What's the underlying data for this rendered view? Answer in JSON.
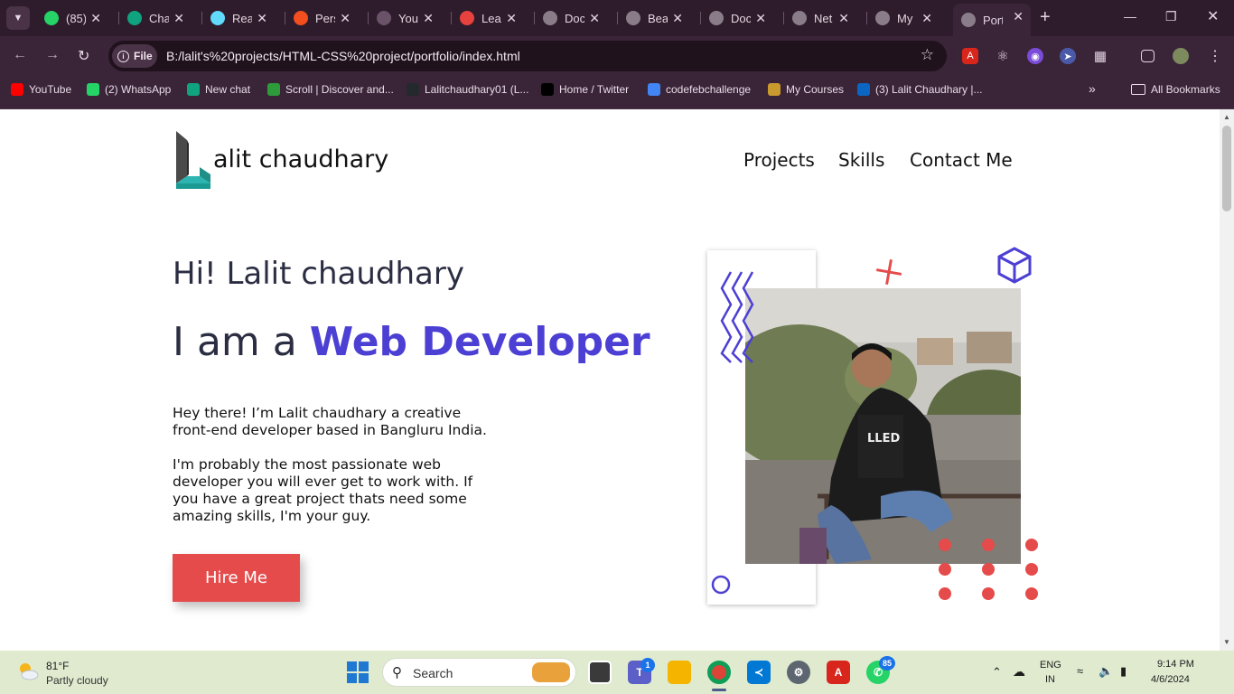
{
  "browser": {
    "tabs": [
      {
        "title": "(85)",
        "icon": "whatsapp-icon",
        "color": "#25d366"
      },
      {
        "title": "Cha",
        "icon": "chatgpt-icon",
        "color": "#10a37f"
      },
      {
        "title": "Rea",
        "icon": "react-icon",
        "color": "#61dafb"
      },
      {
        "title": "Pers",
        "icon": "figma-icon",
        "color": "#f24e1e"
      },
      {
        "title": "You",
        "icon": "loading-icon",
        "color": "#6a5268"
      },
      {
        "title": "Lea",
        "icon": "leetcode-icon",
        "color": "#e8423f"
      },
      {
        "title": "Doc",
        "icon": "globe-icon",
        "color": "#8a7d89"
      },
      {
        "title": "Bea",
        "icon": "globe-icon",
        "color": "#8a7d89"
      },
      {
        "title": "Doc",
        "icon": "globe-icon",
        "color": "#8a7d89"
      },
      {
        "title": "Net",
        "icon": "globe-icon",
        "color": "#8a7d89"
      },
      {
        "title": "My",
        "icon": "globe-icon",
        "color": "#8a7d89"
      },
      {
        "title": "Port",
        "icon": "globe-icon",
        "color": "#8a7d89"
      }
    ],
    "active_tab_index": 11,
    "site_chip": "File",
    "url": "B:/lalit's%20projects/HTML-CSS%20project/portfolio/index.html",
    "bookmarks": [
      {
        "label": "YouTube",
        "icon": "youtube-icon",
        "color": "#ff0000"
      },
      {
        "label": "(2) WhatsApp",
        "icon": "whatsapp-icon",
        "color": "#25d366"
      },
      {
        "label": "New chat",
        "icon": "chatgpt-icon",
        "color": "#10a37f"
      },
      {
        "label": "Scroll | Discover and...",
        "icon": "scroll-icon",
        "color": "#2e9b3b"
      },
      {
        "label": "Lalitchaudhary01 (L...",
        "icon": "github-icon",
        "color": "#24292e"
      },
      {
        "label": "Home / Twitter",
        "icon": "x-twitter-icon",
        "color": "#000000"
      },
      {
        "label": "codefebchallenge",
        "icon": "google-docs-icon",
        "color": "#4285f4"
      },
      {
        "label": "My Courses",
        "icon": "courses-icon",
        "color": "#c99a2e"
      },
      {
        "label": "(3) Lalit Chaudhary |...",
        "icon": "linkedin-icon",
        "color": "#0a66c2"
      }
    ],
    "all_bookmarks": "All Bookmarks"
  },
  "page": {
    "brand": "alit chaudhary",
    "nav": [
      "Projects",
      "Skills",
      "Contact Me"
    ],
    "greeting": "Hi! Lalit chaudhary",
    "headline_prefix": "I am a",
    "headline_highlight": "Web Developer",
    "intro_1": "Hey there! I’m Lalit chaudhary a creative front-end developer based in Bangluru India.",
    "intro_2": "I'm probably the most passionate web developer you will ever get to work with. If you have a great project thats need some amazing skills, I'm your guy.",
    "hire_button": "Hire Me",
    "shirt_text": "LLED",
    "accent_color": "#4c3fd3",
    "button_color": "#e54b4b"
  },
  "taskbar": {
    "weather_temp": "81°F",
    "weather_desc": "Partly cloudy",
    "search_label": "Search",
    "teams_badge": "1",
    "whatsapp_badge": "85",
    "lang_top": "ENG",
    "lang_bottom": "IN",
    "time": "9:14 PM",
    "date": "4/6/2024"
  }
}
